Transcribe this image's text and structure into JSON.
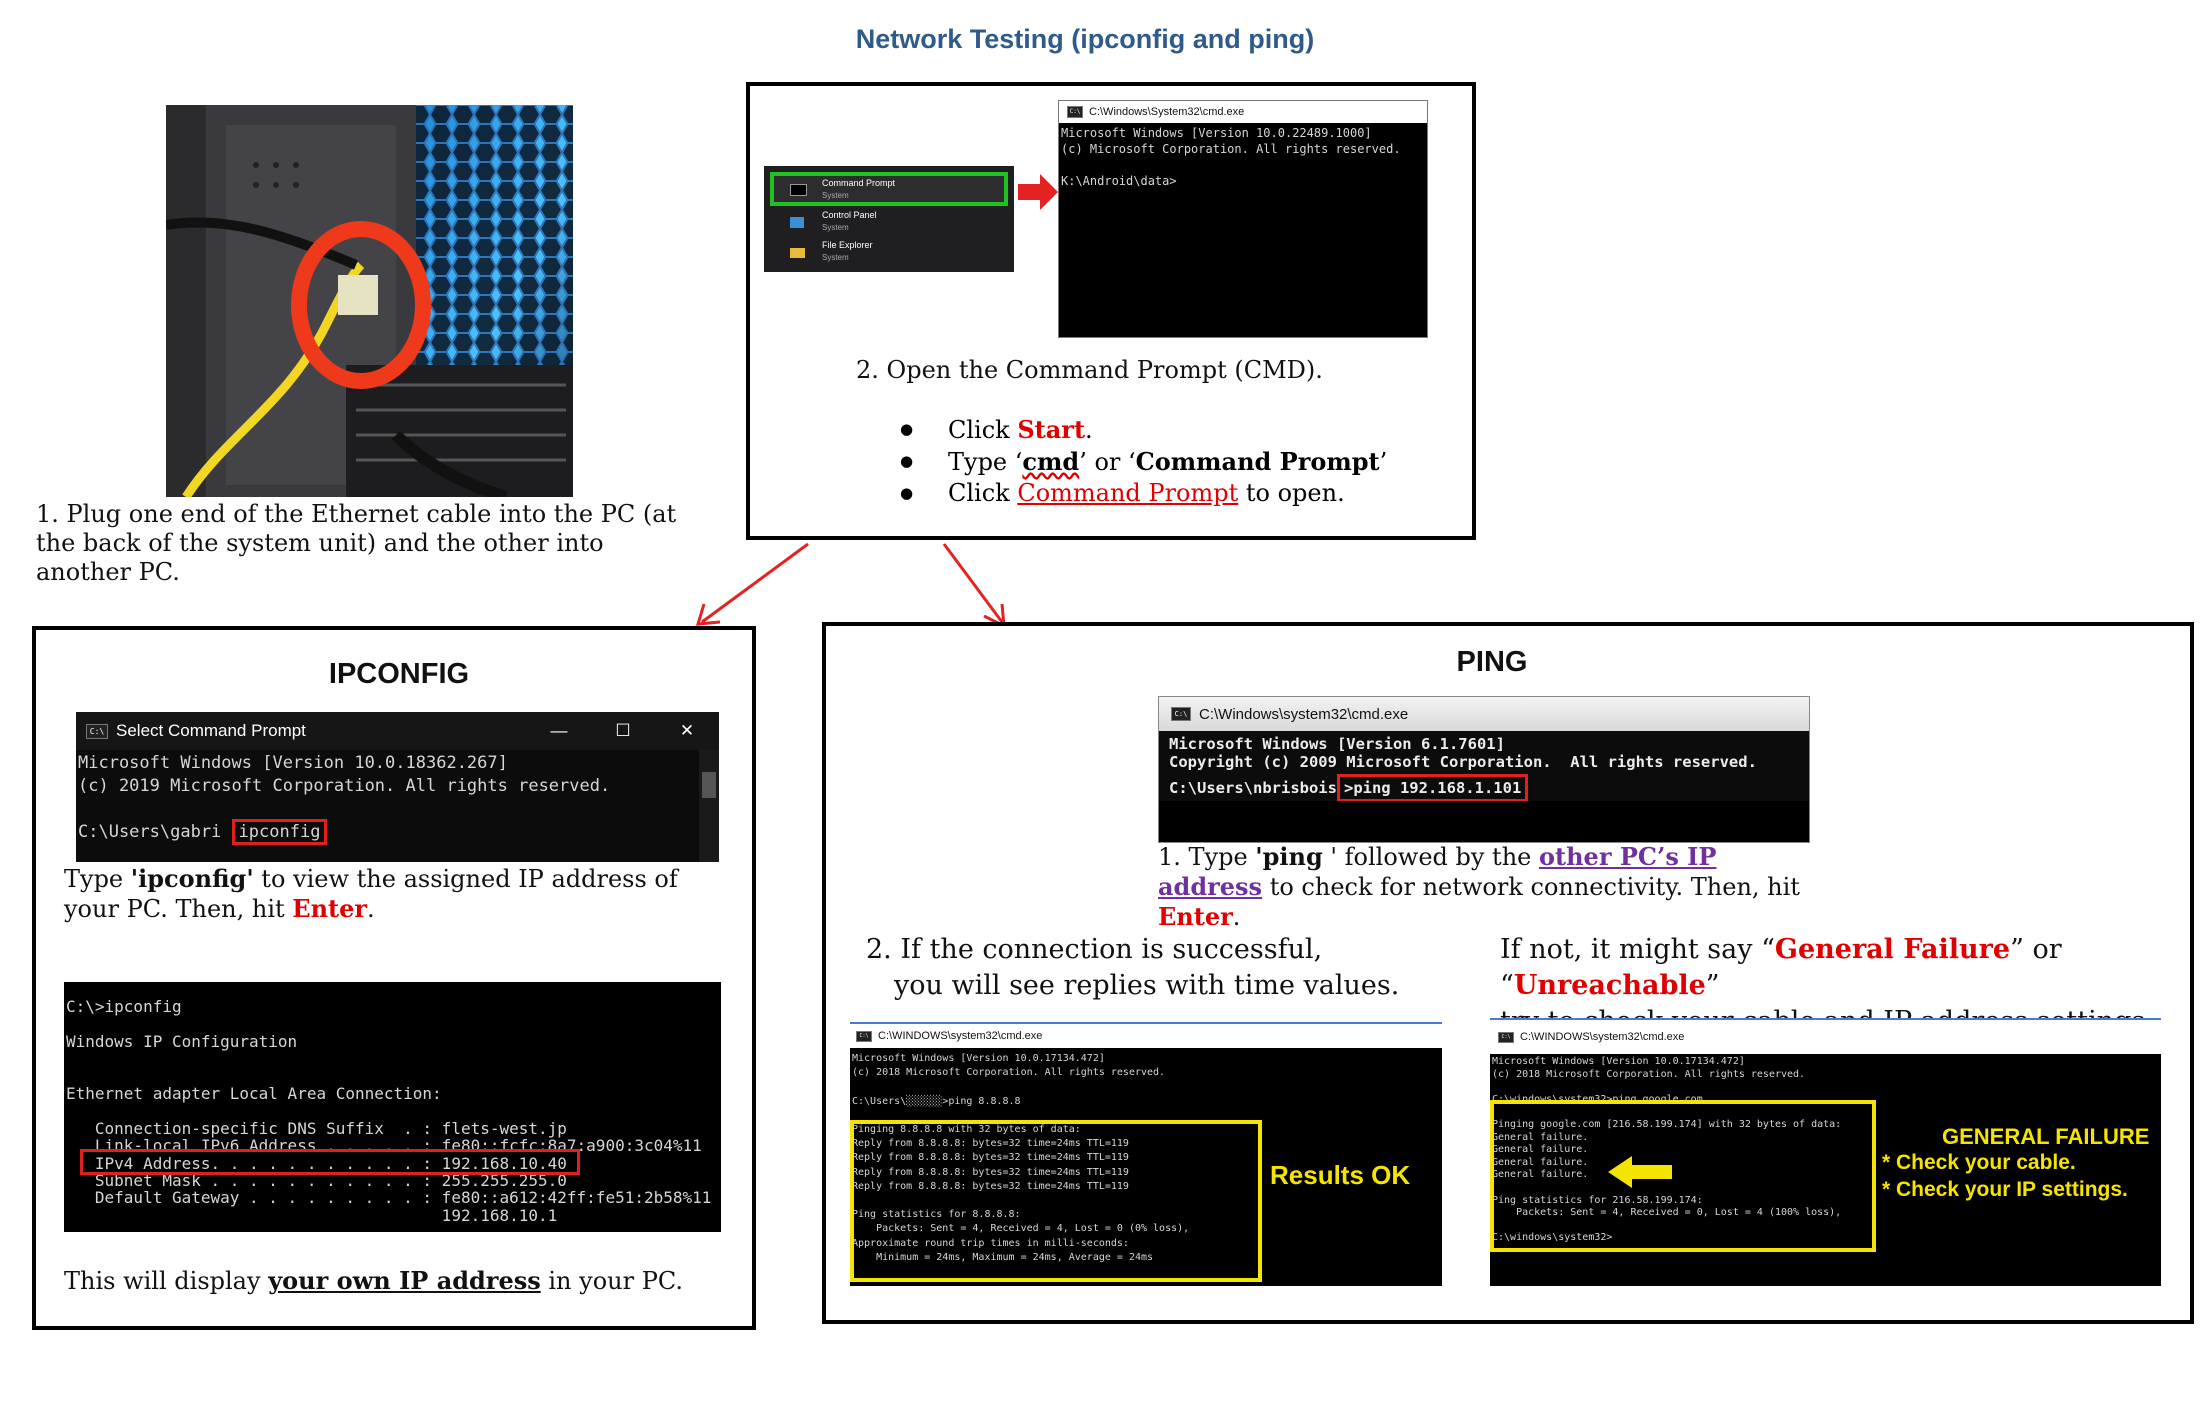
{
  "title": "Network Testing (ipconfig and ping)",
  "step1": {
    "text": "1. Plug one end of the Ethernet cable into the PC (at the back of the system unit) and the other into another PC."
  },
  "cmd_panel": {
    "start_menu": [
      {
        "name": "Command Prompt",
        "sub": "System"
      },
      {
        "name": "Control Panel",
        "sub": "System"
      },
      {
        "name": "File Explorer",
        "sub": "System"
      }
    ],
    "window_title": "C:\\Windows\\System32\\cmd.exe",
    "lines": [
      "Microsoft Windows [Version 10.0.22489.1000]",
      "(c) Microsoft Corporation. All rights reserved.",
      "",
      "K:\\Android\\data>"
    ],
    "step_text": "2. Open the Command Prompt (CMD).",
    "bullets": [
      {
        "pre": "Click ",
        "em": "Start",
        "post": "."
      },
      {
        "pre": "Type ",
        "q1": "‘",
        "em": "cmd",
        "mid": "’ or ‘",
        "em2": "Command Prompt",
        "post": "’"
      },
      {
        "pre": "Click ",
        "em": "Command Prompt",
        "post": " to open."
      }
    ]
  },
  "ipconfig": {
    "heading": "IPCONFIG",
    "win1": {
      "title": "Select Command Prompt",
      "controls": [
        "—",
        "☐",
        "✕"
      ],
      "line1": "Microsoft Windows [Version 10.0.18362.267]",
      "line2": "(c) 2019 Microsoft Corporation. All rights reserved.",
      "prompt": "C:\\Users\\gabri",
      "command": "ipconfig"
    },
    "desc": {
      "pre": "Type ",
      "em": "'ipconfig'",
      "mid": " to view the assigned IP address of your PC. Then, hit ",
      "key": "Enter",
      "post": "."
    },
    "win2": [
      "C:\\>ipconfig",
      "",
      "Windows IP Configuration",
      "",
      "",
      "Ethernet adapter Local Area Connection:",
      "",
      "   Connection-specific DNS Suffix  . : flets-west.jp",
      "   Link-local IPv6 Address . . . . . : fe80::fcfc:8a7:a900:3c04%11",
      "   IPv4 Address. . . . . . . . . . . : 192.168.10.40",
      "   Subnet Mask . . . . . . . . . . . : 255.255.255.0",
      "   Default Gateway . . . . . . . . . : fe80::a612:42ff:fe51:2b58%11",
      "                                       192.168.10.1"
    ],
    "footer": {
      "pre": "This will display ",
      "em": "your own IP address",
      "post": " in your PC."
    }
  },
  "ping": {
    "heading": "PING",
    "win1": {
      "title": "C:\\Windows\\system32\\cmd.exe",
      "line1": "Microsoft Windows [Version 6.1.7601]",
      "line2": "Copyright (c) 2009 Microsoft Corporation.  All rights reserved.",
      "prompt": "C:\\Users\\nbrisbois",
      "command": ">ping 192.168.1.101"
    },
    "step1": {
      "pre": "1. Type ",
      "em": "'ping",
      "mid": " ' followed by the ",
      "link": "other PC’s IP address",
      "mid2": " to check for network connectivity. Then, hit ",
      "key": "Enter",
      "post": "."
    },
    "step2_line1": "2. If the connection is successful,",
    "step2_line2": "you will see replies with time values.",
    "fail": {
      "pre": "If not, it might say “",
      "em1": "General Failure",
      "mid": "” or “",
      "em2": "Unreachable",
      "post": "”",
      "line2": "try to check your cable and IP address settings."
    },
    "ok_win": {
      "title": "C:\\WINDOWS\\system32\\cmd.exe",
      "lines": [
        "Microsoft Windows [Version 10.0.17134.472]",
        "(c) 2018 Microsoft Corporation. All rights reserved.",
        "",
        "C:\\Users\\░░░░░░>ping 8.8.8.8",
        "",
        "Pinging 8.8.8.8 with 32 bytes of data:",
        "Reply from 8.8.8.8: bytes=32 time=24ms TTL=119",
        "Reply from 8.8.8.8: bytes=32 time=24ms TTL=119",
        "Reply from 8.8.8.8: bytes=32 time=24ms TTL=119",
        "Reply from 8.8.8.8: bytes=32 time=24ms TTL=119",
        "",
        "Ping statistics for 8.8.8.8:",
        "    Packets: Sent = 4, Received = 4, Lost = 0 (0% loss),",
        "Approximate round trip times in milli-seconds:",
        "    Minimum = 24ms, Maximum = 24ms, Average = 24ms"
      ],
      "label": "Results OK"
    },
    "fail_win": {
      "title": "C:\\WINDOWS\\system32\\cmd.exe",
      "lines": [
        "Microsoft Windows [Version 10.0.17134.472]",
        "(c) 2018 Microsoft Corporation. All rights reserved.",
        "",
        "C:\\windows\\system32>ping google.com",
        "",
        "Pinging google.com [216.58.199.174] with 32 bytes of data:",
        "General failure.",
        "General failure.",
        "General failure.",
        "General failure.",
        "",
        "Ping statistics for 216.58.199.174:",
        "    Packets: Sent = 4, Received = 0, Lost = 4 (100% loss),",
        "",
        "C:\\windows\\system32>"
      ],
      "label1": "GENERAL FAILURE",
      "label2": "* Check your cable.",
      "label3": "* Check your IP settings."
    }
  },
  "colors": {
    "title": "#2f5a8c",
    "red": "#e00000",
    "yellow": "#f5e400",
    "green": "#22c122",
    "purple": "#7030a0"
  }
}
